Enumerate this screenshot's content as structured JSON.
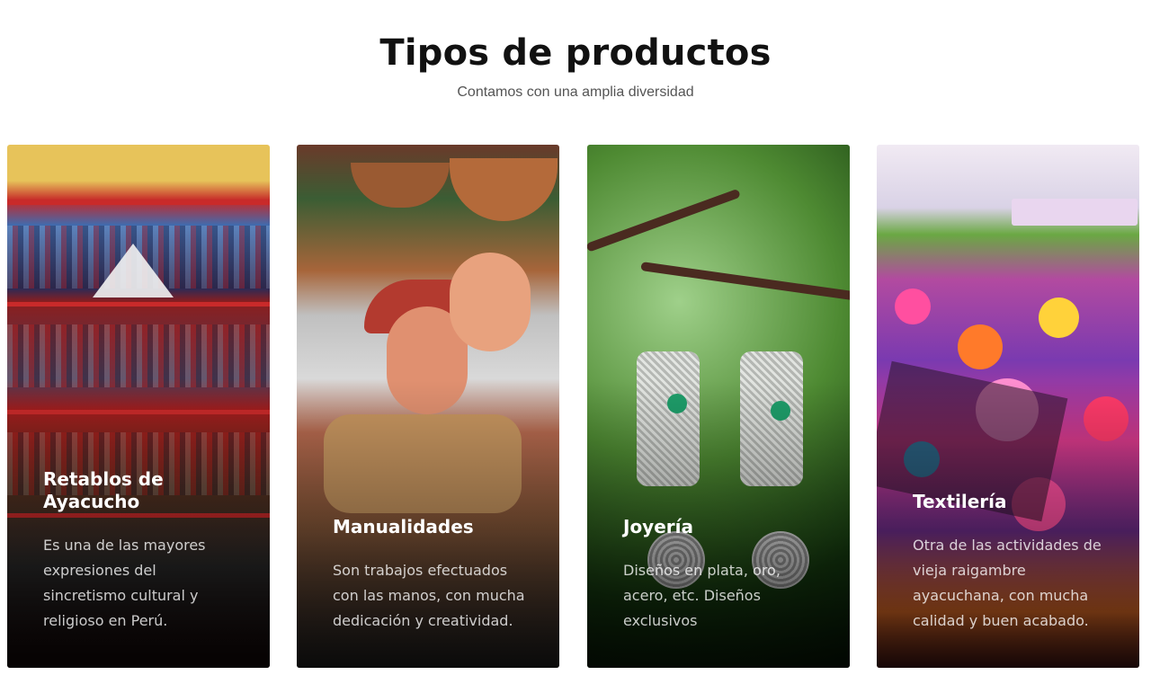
{
  "header": {
    "title": "Tipos de productos",
    "subtitle": "Contamos con una amplia diversidad"
  },
  "cards": [
    {
      "title": "Retablos de Ayacucho",
      "text": "Es una de las mayores expresiones del sincretismo cultural y religioso en Perú."
    },
    {
      "title": "Manualidades",
      "text": "Son trabajos efectuados con las manos, con mucha dedicación y creatividad."
    },
    {
      "title": "Joyería",
      "text": "Diseños en plata, oro, acero, etc. Diseños exclusivos"
    },
    {
      "title": "Textilería",
      "text": "Otra de las actividades de vieja raigambre ayacuchana, con mucha calidad y buen acabado."
    }
  ]
}
